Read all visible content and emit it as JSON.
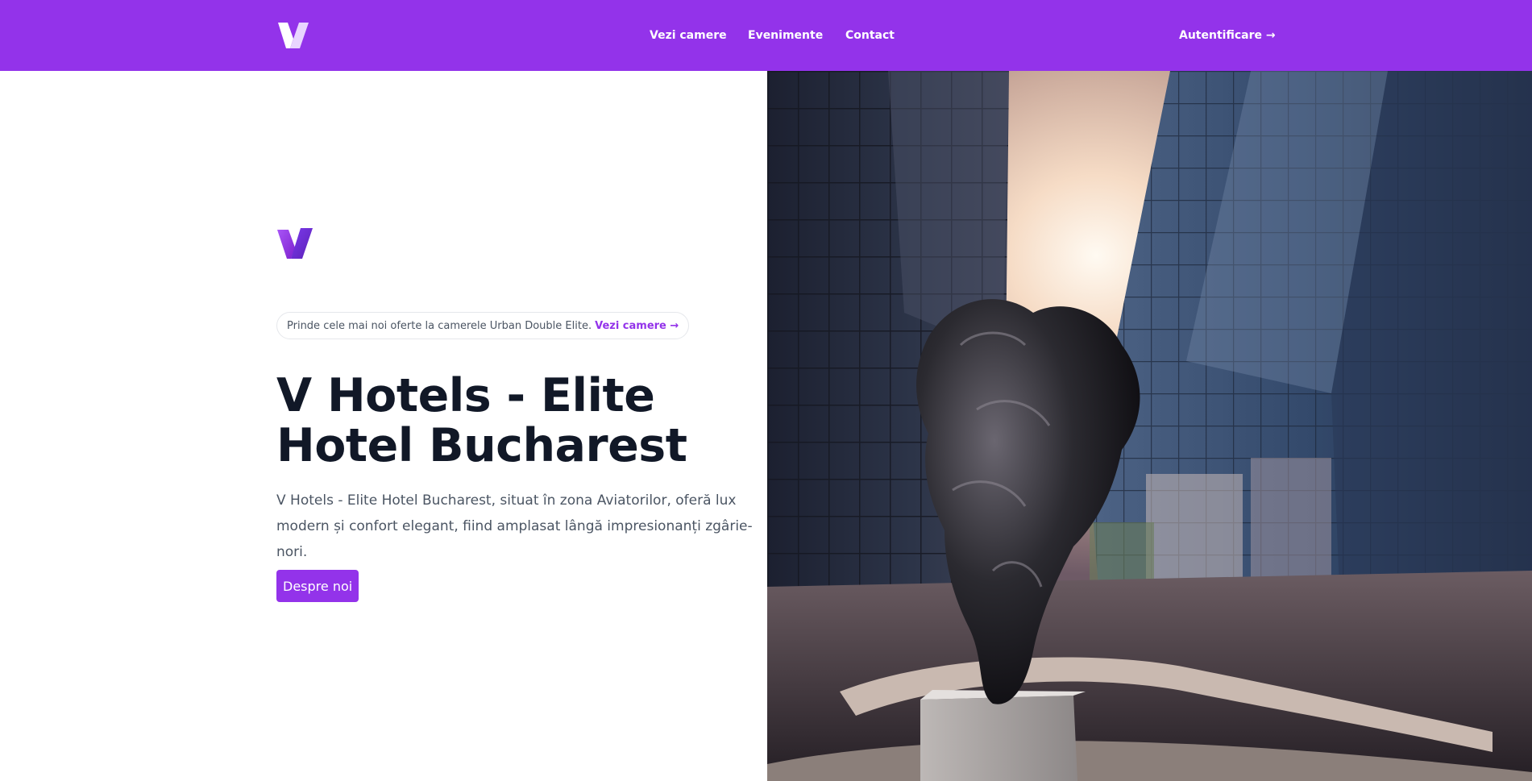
{
  "brand": {
    "name": "V Hotels",
    "color": "#9333ea"
  },
  "nav": {
    "rooms_label": "Vezi camere",
    "events_label": "Evenimente",
    "contact_label": "Contact",
    "login_label": "Autentificare →"
  },
  "hero": {
    "promo_text": "Prinde cele mai noi oferte la camerele Urban Double Elite.",
    "promo_link": "Vezi camere →",
    "title": "V Hotels - Elite Hotel Bucharest",
    "description": "V Hotels - Elite Hotel Bucharest, situat în zona Aviatorilor, oferă lux modern și confort elegant, fiind amplasat lângă impresionanți zgârie-nori.",
    "cta_label": "Despre noi"
  },
  "image": {
    "subject": "hotel-skyscrapers-sculpture"
  },
  "colors": {
    "accent": "#9333ea",
    "title": "#111827",
    "body_text": "#4b5563"
  }
}
